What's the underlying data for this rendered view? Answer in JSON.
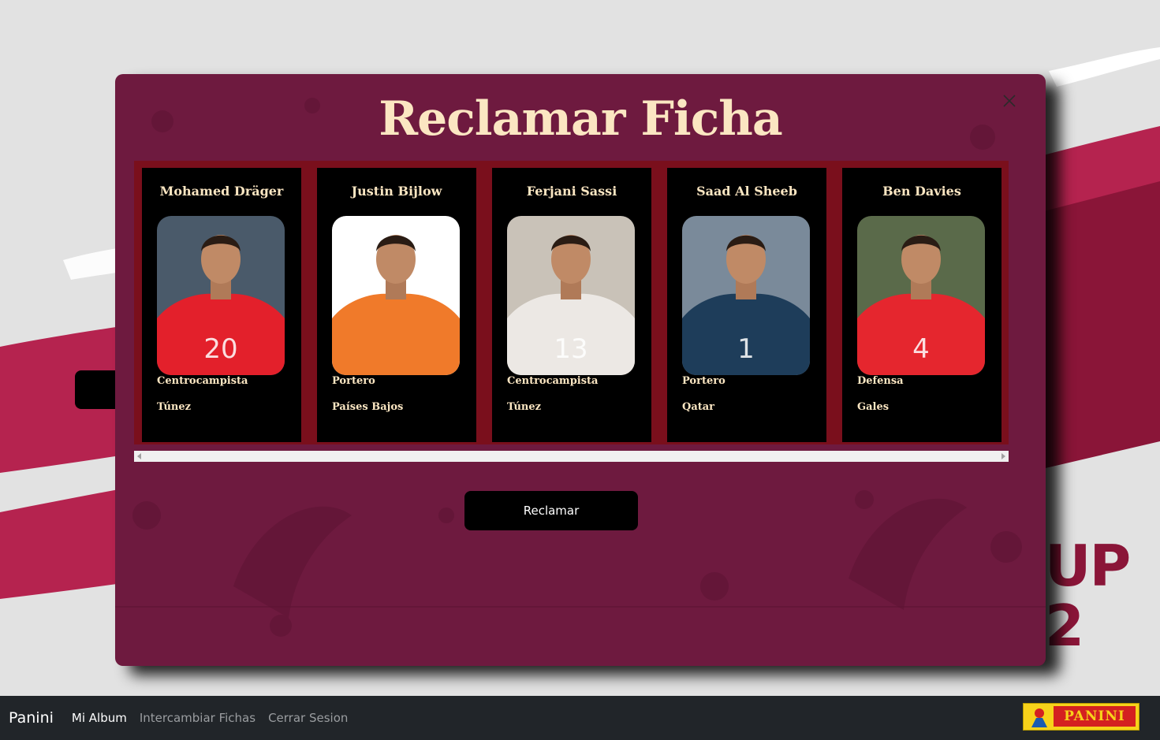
{
  "modal": {
    "title": "Reclamar Ficha",
    "claim_label": "Reclamar",
    "close_icon": "close-icon"
  },
  "cards": [
    {
      "name": "Mohamed Dräger",
      "position": "Centrocampista",
      "country": "Túnez",
      "shirt_color": "#e3202b",
      "shirt_number": "20",
      "photo_bg": "#4a5a6a"
    },
    {
      "name": "Justin Bijlow",
      "position": "Portero",
      "country": "Países Bajos",
      "shirt_color": "#f07a2a",
      "shirt_number": "",
      "photo_bg": "#ffffff"
    },
    {
      "name": "Ferjani Sassi",
      "position": "Centrocampista",
      "country": "Túnez",
      "shirt_color": "#ece8e4",
      "shirt_number": "13",
      "photo_bg": "#c9c2b8"
    },
    {
      "name": "Saad Al Sheeb",
      "position": "Portero",
      "country": "Qatar",
      "shirt_color": "#1e3d5a",
      "shirt_number": "1",
      "photo_bg": "#7a8a9a"
    },
    {
      "name": "Ben Davies",
      "position": "Defensa",
      "country": "Gales",
      "shirt_color": "#e5262e",
      "shirt_number": "4",
      "photo_bg": "#5a6a4a"
    }
  ],
  "navbar": {
    "brand": "Panini",
    "links": [
      "Mi Album",
      "Intercambiar Fichas",
      "Cerrar Sesion"
    ],
    "logo_text": "PANINI"
  },
  "background": {
    "partial_text_line1": "UP",
    "partial_text_line2": "2"
  },
  "colors": {
    "modal_bg": "#6e1a3f",
    "title": "#fbe6c2",
    "card_frame": "#7a0f1c",
    "navbar": "#212529",
    "accent": "#8a1538"
  }
}
